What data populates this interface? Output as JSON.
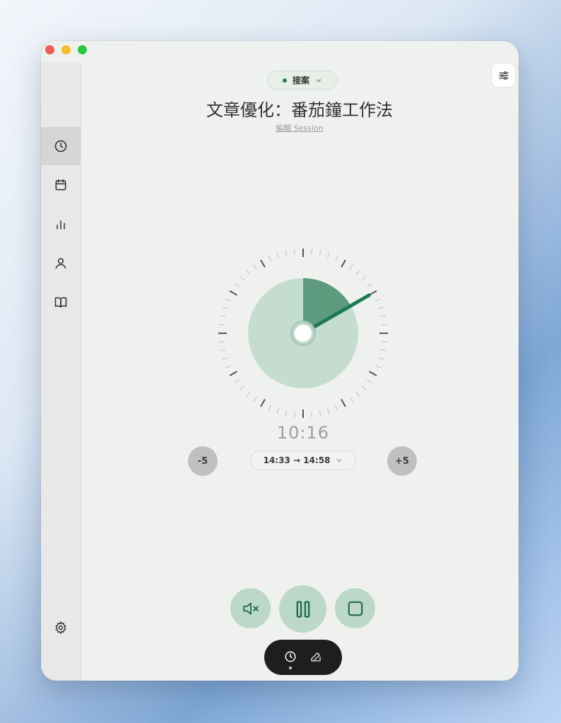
{
  "header": {
    "status_label": "接案",
    "status_color": "#2f7b58",
    "title": "文章優化：番茄鐘工作法",
    "edit_link": "編輯 Session"
  },
  "sidebar": {
    "items": [
      {
        "icon": "clock-icon",
        "active": true
      },
      {
        "icon": "calendar-icon",
        "active": false
      },
      {
        "icon": "bar-chart-icon",
        "active": false
      },
      {
        "icon": "user-icon",
        "active": false
      },
      {
        "icon": "book-icon",
        "active": false
      }
    ],
    "footer_icon": "gear-icon"
  },
  "timer": {
    "display": "10:16",
    "minus_label": "-5",
    "plus_label": "+5",
    "range_label": "14:33 → 14:58",
    "accent_color": "#1e7a52",
    "elapsed_color": "#5e9a7d",
    "remaining_color": "#c5ddd1"
  },
  "controls": {
    "mute_icon": "speaker-muted-icon",
    "pause_icon": "pause-icon",
    "stop_icon": "stop-icon"
  },
  "bottom_bar": {
    "items": [
      "timer-icon",
      "edit-icon"
    ]
  }
}
